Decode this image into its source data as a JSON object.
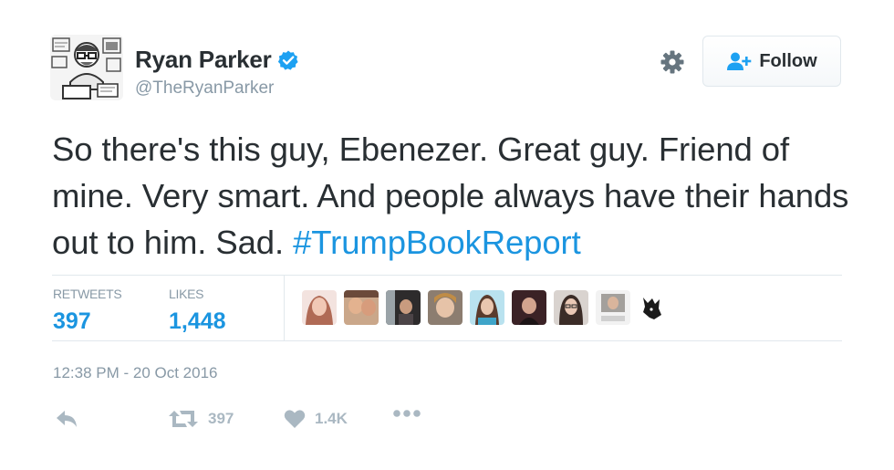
{
  "user": {
    "display_name": "Ryan Parker",
    "handle": "@TheRyanParker",
    "verified": true
  },
  "header": {
    "follow_label": "Follow"
  },
  "tweet": {
    "text": "So there's this guy, Ebenezer. Great guy. Friend of mine. Very smart. And people always have their hands out to him. Sad. ",
    "hashtag": "#TrumpBookReport",
    "timestamp": "12:38 PM - 20 Oct 2016"
  },
  "stats": {
    "retweets_label": "RETWEETS",
    "retweets_value": "397",
    "likes_label": "LIKES",
    "likes_value": "1,448"
  },
  "actions": {
    "retweet_count": "397",
    "like_count": "1.4K"
  },
  "colors": {
    "accent": "#1b95e0",
    "muted": "#8899a6",
    "icon_muted": "#aab8c2",
    "text": "#292f33",
    "divider": "#e1e8ed"
  },
  "icons": {
    "gear": "gear-icon",
    "follow": "add-user-icon",
    "verified": "verified-badge-icon",
    "reply": "reply-icon",
    "retweet": "retweet-icon",
    "like": "heart-icon",
    "more": "more-dots-icon"
  }
}
